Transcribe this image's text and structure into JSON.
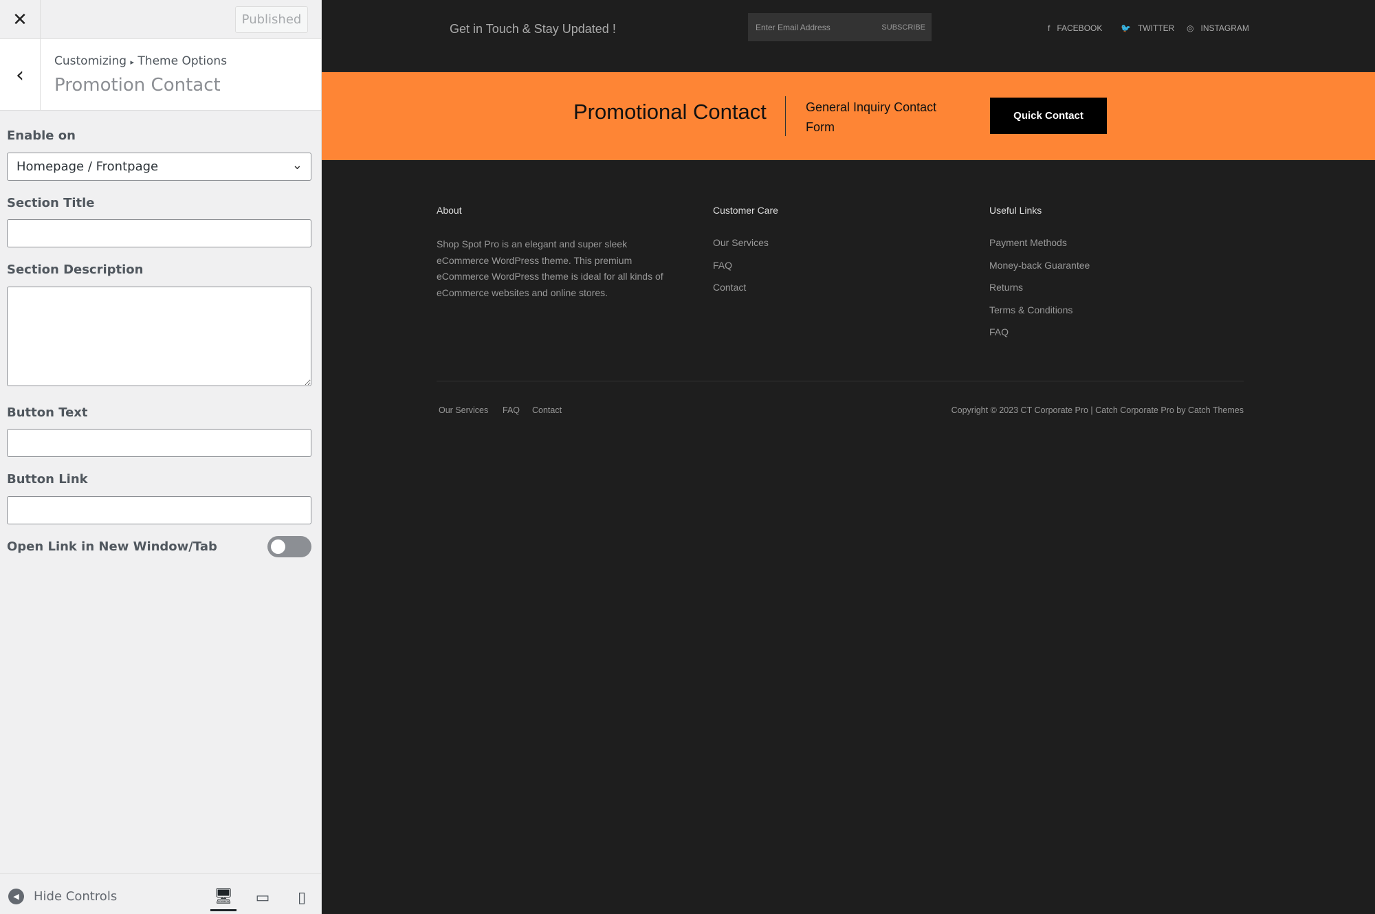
{
  "sidebar": {
    "published_label": "Published",
    "breadcrumb": {
      "root": "Customizing",
      "separator": "▸",
      "parent": "Theme Options"
    },
    "title": "Promotion Contact",
    "fields": {
      "enable_on": {
        "label": "Enable on",
        "value": "Homepage / Frontpage"
      },
      "section_title": {
        "label": "Section Title",
        "value": ""
      },
      "section_description": {
        "label": "Section Description",
        "value": ""
      },
      "button_text": {
        "label": "Button Text",
        "value": ""
      },
      "button_link": {
        "label": "Button Link",
        "value": ""
      },
      "open_new_window": {
        "label": "Open Link in New Window/Tab",
        "checked": false
      }
    },
    "footer": {
      "hide_controls": "Hide Controls",
      "active_device": "desktop"
    }
  },
  "preview": {
    "topbar": {
      "tagline": "Get in Touch & Stay Updated !",
      "email_placeholder": "Enter Email Address",
      "subscribe": "SUBSCRIBE",
      "social": [
        {
          "icon": "facebook-icon",
          "label": "FACEBOOK"
        },
        {
          "icon": "twitter-icon",
          "label": "TWITTER"
        },
        {
          "icon": "instagram-icon",
          "label": "INSTAGRAM"
        }
      ]
    },
    "promo": {
      "title": "Promotional Contact",
      "subtitle_line1": "General Inquiry Contact",
      "subtitle_line2": "Form",
      "button": "Quick Contact",
      "color": "#fe8535"
    },
    "footer": {
      "about": {
        "heading": "About",
        "text": [
          "Shop Spot Pro is an elegant and super sleek",
          "eCommerce WordPress theme. This premium",
          "eCommerce WordPress theme is ideal for all kinds of",
          "eCommerce websites and online stores."
        ]
      },
      "customer_care": {
        "heading": "Customer Care",
        "links": [
          "Our Services",
          "FAQ",
          "Contact"
        ]
      },
      "useful_links": {
        "heading": "Useful Links",
        "links": [
          "Payment Methods",
          "Money-back Guarantee",
          "Returns",
          "Terms & Conditions",
          "FAQ"
        ]
      },
      "bottom_links": [
        "Our Services",
        "FAQ",
        "Contact"
      ],
      "copyright": "Copyright © 2023 CT Corporate Pro | Catch Corporate Pro by Catch Themes"
    }
  }
}
